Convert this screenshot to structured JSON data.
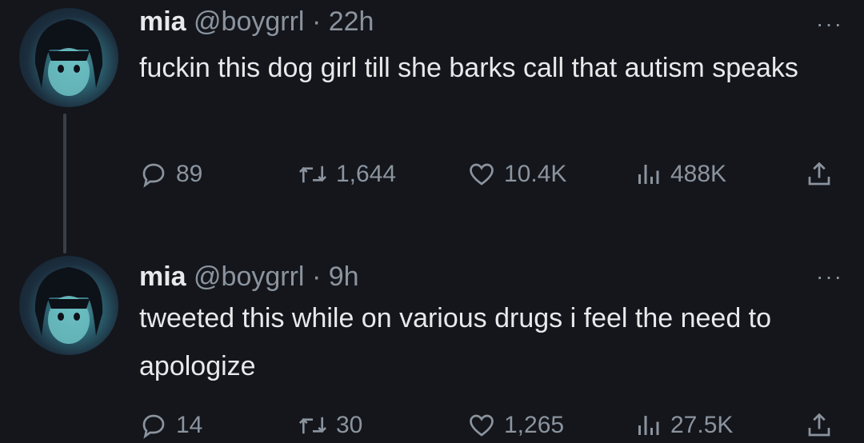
{
  "tweets": [
    {
      "name": "mia",
      "handle": "@boygrrl",
      "separator": "·",
      "time": "22h",
      "more": "···",
      "text": "fuckin this dog girl till she barks call that autism speaks",
      "replies": "89",
      "retweets": "1,644",
      "likes": "10.4K",
      "views": "488K"
    },
    {
      "name": "mia",
      "handle": "@boygrrl",
      "separator": "·",
      "time": "9h",
      "more": "···",
      "text": "tweeted this while on various drugs i feel the need to apologize",
      "replies": "14",
      "retweets": "30",
      "likes": "1,265",
      "views": "27.5K"
    }
  ],
  "icons": {
    "reply": "reply-icon",
    "retweet": "retweet-icon",
    "like": "heart-icon",
    "views": "views-icon",
    "share": "share-icon",
    "more": "more-icon"
  },
  "colors": {
    "background": "#14161c",
    "text": "#e7e9ea",
    "muted": "#8b949e"
  }
}
